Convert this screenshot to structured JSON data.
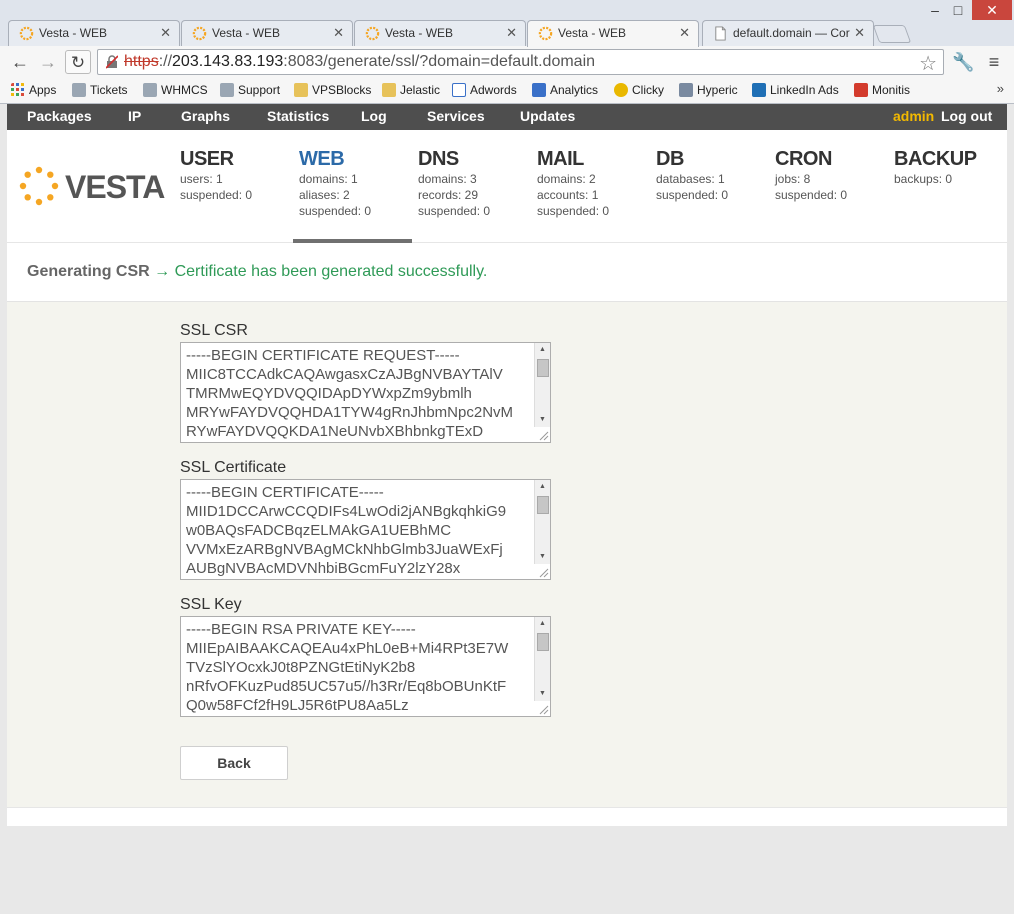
{
  "browser": {
    "tabs": [
      {
        "title": "Vesta - WEB",
        "active": false
      },
      {
        "title": "Vesta - WEB",
        "active": false
      },
      {
        "title": "Vesta - WEB",
        "active": false
      },
      {
        "title": "Vesta - WEB",
        "active": true
      },
      {
        "title": "default.domain — Cor",
        "active": false
      }
    ],
    "window_controls": {
      "minimize": "–",
      "maximize": "□",
      "close": "✕"
    },
    "url": {
      "scheme": "https",
      "rest_prefix": "://",
      "host": "203.143.83.193",
      "path": ":8083/generate/ssl/?domain=default.domain"
    },
    "bookmarks": [
      {
        "label": "Apps",
        "icon": "apps-grid-icon",
        "color": "#d94a3a"
      },
      {
        "label": "Tickets",
        "icon": "ticket-icon",
        "color": "#8a9aa8"
      },
      {
        "label": "WHMCS",
        "icon": "whmcs-icon",
        "color": "#8a9aa8"
      },
      {
        "label": "Support",
        "icon": "support-icon",
        "color": "#8a9aa8"
      },
      {
        "label": "VPSBlocks",
        "icon": "folder-icon",
        "color": "#e7c25a"
      },
      {
        "label": "Jelastic",
        "icon": "folder-icon",
        "color": "#e7c25a"
      },
      {
        "label": "Adwords",
        "icon": "google-icon",
        "color": "#3a70c8"
      },
      {
        "label": "Analytics",
        "icon": "google-icon",
        "color": "#3a70c8"
      },
      {
        "label": "Clicky",
        "icon": "clicky-icon",
        "color": "#e9b800"
      },
      {
        "label": "Hyperic",
        "icon": "hyperic-icon",
        "color": "#7a8aa0"
      },
      {
        "label": "LinkedIn Ads",
        "icon": "linkedin-icon",
        "color": "#1f6fb5"
      },
      {
        "label": "Monitis",
        "icon": "monitis-icon",
        "color": "#d33b2c"
      }
    ],
    "bookmarks_more": "»"
  },
  "topnav": {
    "items": [
      "Packages",
      "IP",
      "Graphs",
      "Statistics",
      "Log",
      "Services",
      "Updates"
    ],
    "user": "admin",
    "logout": "Log out"
  },
  "logo": {
    "text": "VESTA",
    "color": "#f5a623"
  },
  "stats": [
    {
      "title": "USER",
      "lines": [
        "users: 1",
        "suspended: 0"
      ],
      "active": false
    },
    {
      "title": "WEB",
      "lines": [
        "domains: 1",
        "aliases: 2",
        "suspended: 0"
      ],
      "active": true
    },
    {
      "title": "DNS",
      "lines": [
        "domains: 3",
        "records: 29",
        "suspended: 0"
      ],
      "active": false
    },
    {
      "title": "MAIL",
      "lines": [
        "domains: 2",
        "accounts: 1",
        "suspended: 0"
      ],
      "active": false
    },
    {
      "title": "DB",
      "lines": [
        "databases: 1",
        "suspended: 0"
      ],
      "active": false
    },
    {
      "title": "CRON",
      "lines": [
        "jobs: 8",
        "suspended: 0"
      ],
      "active": false
    },
    {
      "title": "BACKUP",
      "lines": [
        "backups: 0"
      ],
      "active": false
    }
  ],
  "breadcrumb": {
    "label": "Generating CSR",
    "arrow": "→",
    "message": "Certificate has been generated successfully."
  },
  "form": {
    "fields": [
      {
        "label": "SSL CSR",
        "lines": [
          "-----BEGIN CERTIFICATE REQUEST-----",
          "MIIC8TCCAdkCAQAwgasxCzAJBgNVBAYTAlV",
          "TMRMwEQYDVQQIDApDYWxpZm9ybmlh",
          "MRYwFAYDVQQHDA1TYW4gRnJhbmNpc2NvM",
          "RYwFAYDVQQKDA1NeUNvbXBhbnkgTExD"
        ]
      },
      {
        "label": "SSL Certificate",
        "lines": [
          "-----BEGIN CERTIFICATE-----",
          "MIID1DCCArwCCQDIFs4LwOdi2jANBgkqhkiG9",
          "w0BAQsFADCBqzELMAkGA1UEBhMC",
          "VVMxEzARBgNVBAgMCkNhbGlmb3JuaWExFj",
          "AUBgNVBAcMDVNhbiBGcmFuY2lzY28x"
        ]
      },
      {
        "label": "SSL Key",
        "lines": [
          "-----BEGIN RSA PRIVATE KEY-----",
          "MIIEpAIBAAKCAQEAu4xPhL0eB+Mi4RPt3E7W",
          "TVzSlYOcxkJ0t8PZNGtEtiNyK2b8",
          "nRfvOFKuzPud85UC57u5//h3Rr/Eq8bOBUnKtF",
          "Q0w58FCf2fH9LJ5R6tPU8Aa5Lz"
        ]
      }
    ],
    "back_label": "Back"
  },
  "colors": {
    "accent_active": "#2c6aa8",
    "success": "#2f9a57",
    "user_highlight": "#f3b900",
    "nav_bg": "#4e4e4e",
    "form_bg": "#f4f4ee"
  }
}
